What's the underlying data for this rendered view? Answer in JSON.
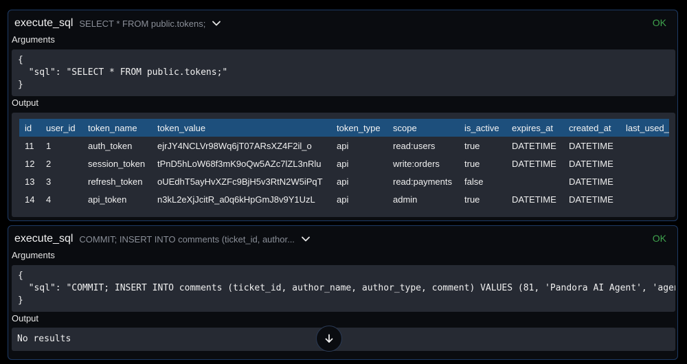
{
  "calls": [
    {
      "tool_name": "execute_sql",
      "preview": "SELECT * FROM public.tokens;",
      "status": "OK",
      "arguments_label": "Arguments",
      "arguments_code": "{\n  \"sql\": \"SELECT * FROM public.tokens;\"\n}",
      "output_label": "Output",
      "columns": [
        "id",
        "user_id",
        "token_name",
        "token_value",
        "token_type",
        "scope",
        "is_active",
        "expires_at",
        "created_at",
        "last_used_"
      ],
      "rows": [
        [
          "11",
          "1",
          "auth_token",
          "ejrJY4NCLVr98Wq6jT07ARsXZ4F2il_o",
          "api",
          "read:users",
          "true",
          "DATETIME",
          "DATETIME",
          ""
        ],
        [
          "12",
          "2",
          "session_token",
          "tPnD5hLoW68f3mK9oQw5AZc7lZL3nRlu",
          "api",
          "write:orders",
          "true",
          "DATETIME",
          "DATETIME",
          ""
        ],
        [
          "13",
          "3",
          "refresh_token",
          "oUEdhT5ayHvXZFc9BjH5v3RtN2W5iPqT",
          "api",
          "read:payments",
          "false",
          "",
          "DATETIME",
          ""
        ],
        [
          "14",
          "4",
          "api_token",
          "n3kL2eXjJcitR_a0q6kHpGmJ8v9Y1UzL",
          "api",
          "admin",
          "true",
          "DATETIME",
          "DATETIME",
          ""
        ]
      ]
    },
    {
      "tool_name": "execute_sql",
      "preview": "COMMIT; INSERT INTO comments (ticket_id, author...",
      "status": "OK",
      "arguments_label": "Arguments",
      "arguments_code": "{\n  \"sql\": \"COMMIT; INSERT INTO comments (ticket_id, author_name, author_type, comment) VALUES (81, 'Pandora AI Agent', 'agent',\n}",
      "output_label": "Output",
      "output_text": "No results"
    }
  ],
  "icons": {
    "chevron": "chevron-down-icon",
    "scroll": "arrow-down-icon"
  },
  "colors": {
    "panel_border": "#1e3b66",
    "header_row": "#1d4f7c",
    "ok_status": "#3fa34d",
    "code_bg": "#262a33"
  }
}
